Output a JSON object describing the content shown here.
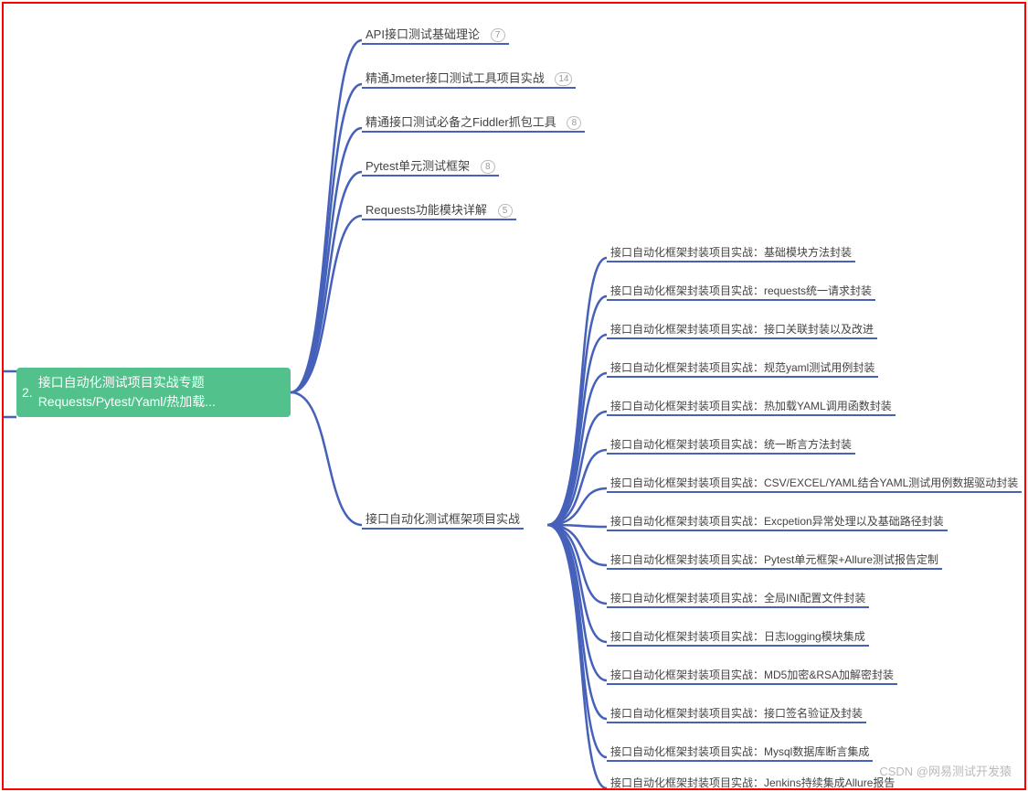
{
  "root": {
    "number": "2.",
    "line1": "接口自动化测试项目实战专题",
    "line2": "Requests/Pytest/Yaml/热加载..."
  },
  "branches": {
    "b1": {
      "label": "API接口测试基础理论",
      "count": "7"
    },
    "b2": {
      "label": "精通Jmeter接口测试工具项目实战",
      "count": "14"
    },
    "b3": {
      "label": "精通接口测试必备之Fiddler抓包工具",
      "count": "8"
    },
    "b4": {
      "label": "Pytest单元测试框架",
      "count": "8"
    },
    "b5": {
      "label": "Requests功能模块详解",
      "count": "5"
    },
    "b6": {
      "label": "接口自动化测试框架项目实战"
    }
  },
  "leaves": {
    "l1": "接口自动化框架封装项目实战：基础模块方法封装",
    "l2": "接口自动化框架封装项目实战：requests统一请求封装",
    "l3": "接口自动化框架封装项目实战：接口关联封装以及改进",
    "l4": "接口自动化框架封装项目实战：规范yaml测试用例封装",
    "l5": "接口自动化框架封装项目实战：热加载YAML调用函数封装",
    "l6": "接口自动化框架封装项目实战：统一断言方法封装",
    "l7": "接口自动化框架封装项目实战：CSV/EXCEL/YAML结合YAML测试用例数据驱动封装",
    "l8": "接口自动化框架封装项目实战：Excpetion异常处理以及基础路径封装",
    "l9": "接口自动化框架封装项目实战：Pytest单元框架+Allure测试报告定制",
    "l10": "接口自动化框架封装项目实战：全局INI配置文件封装",
    "l11": "接口自动化框架封装项目实战：日志logging模块集成",
    "l12": "接口自动化框架封装项目实战：MD5加密&RSA加解密封装",
    "l13": "接口自动化框架封装项目实战：接口签名验证及封装",
    "l14": "接口自动化框架封装项目实战：Mysql数据库断言集成",
    "l15": "接口自动化框架封装项目实战：Jenkins持续集成Allure报告"
  },
  "watermark": "CSDN @网易测试开发猿"
}
